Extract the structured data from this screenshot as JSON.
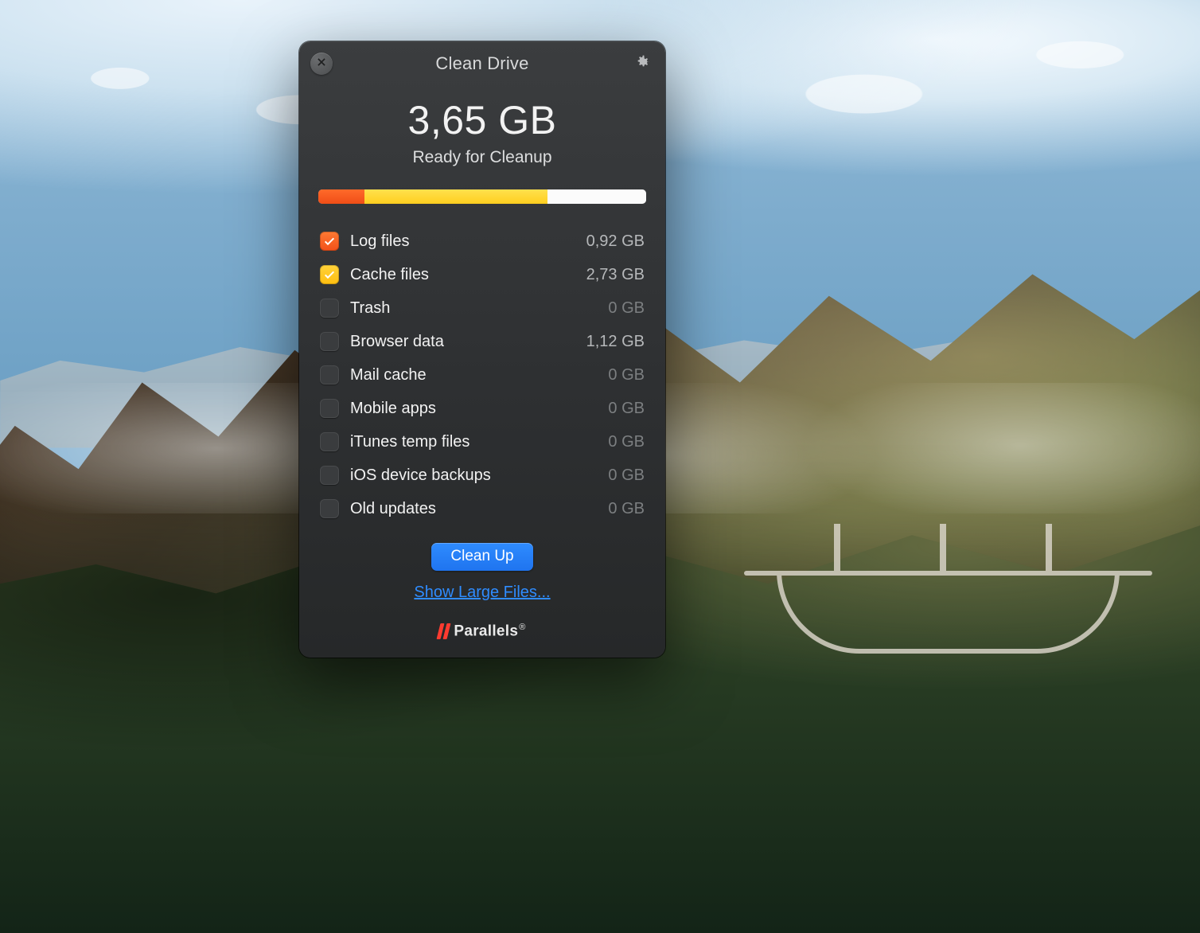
{
  "window": {
    "title": "Clean Drive"
  },
  "summary": {
    "amount": "3,65 GB",
    "subtitle": "Ready for Cleanup"
  },
  "bar": {
    "segments": [
      {
        "color": "orange",
        "percent": 14
      },
      {
        "color": "yellow",
        "percent": 56
      },
      {
        "color": "white",
        "percent": 30
      }
    ]
  },
  "items": [
    {
      "label": "Log files",
      "size": "0,92 GB",
      "checked": true,
      "color": "orange",
      "zero": false
    },
    {
      "label": "Cache files",
      "size": "2,73 GB",
      "checked": true,
      "color": "yellow",
      "zero": false
    },
    {
      "label": "Trash",
      "size": "0 GB",
      "checked": false,
      "color": "",
      "zero": true
    },
    {
      "label": "Browser data",
      "size": "1,12 GB",
      "checked": false,
      "color": "",
      "zero": false
    },
    {
      "label": "Mail cache",
      "size": "0 GB",
      "checked": false,
      "color": "",
      "zero": true
    },
    {
      "label": "Mobile apps",
      "size": "0 GB",
      "checked": false,
      "color": "",
      "zero": true
    },
    {
      "label": "iTunes temp files",
      "size": "0 GB",
      "checked": false,
      "color": "",
      "zero": true
    },
    {
      "label": "iOS device backups",
      "size": "0 GB",
      "checked": false,
      "color": "",
      "zero": true
    },
    {
      "label": "Old updates",
      "size": "0 GB",
      "checked": false,
      "color": "",
      "zero": true
    }
  ],
  "actions": {
    "primary": "Clean Up",
    "link": "Show Large Files..."
  },
  "brand": {
    "name": "Parallels",
    "registered": "®"
  }
}
